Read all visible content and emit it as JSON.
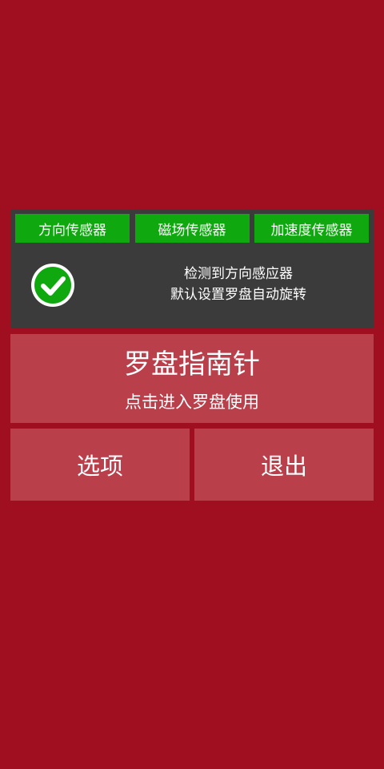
{
  "sensors": {
    "tabs": [
      "方向传感器",
      "磁场传感器",
      "加速度传感器"
    ],
    "status_icon": "check-circle-icon",
    "status_line1": "检测到方向感应器",
    "status_line2": "默认设置罗盘自动旋转"
  },
  "compass": {
    "title": "罗盘指南针",
    "subtitle": "点击进入罗盘使用"
  },
  "buttons": {
    "options": "选项",
    "exit": "退出"
  },
  "colors": {
    "background": "#a00f1f",
    "panel": "#3b3b3b",
    "tab_green": "#0fa80f",
    "button": "#b93f4b"
  }
}
